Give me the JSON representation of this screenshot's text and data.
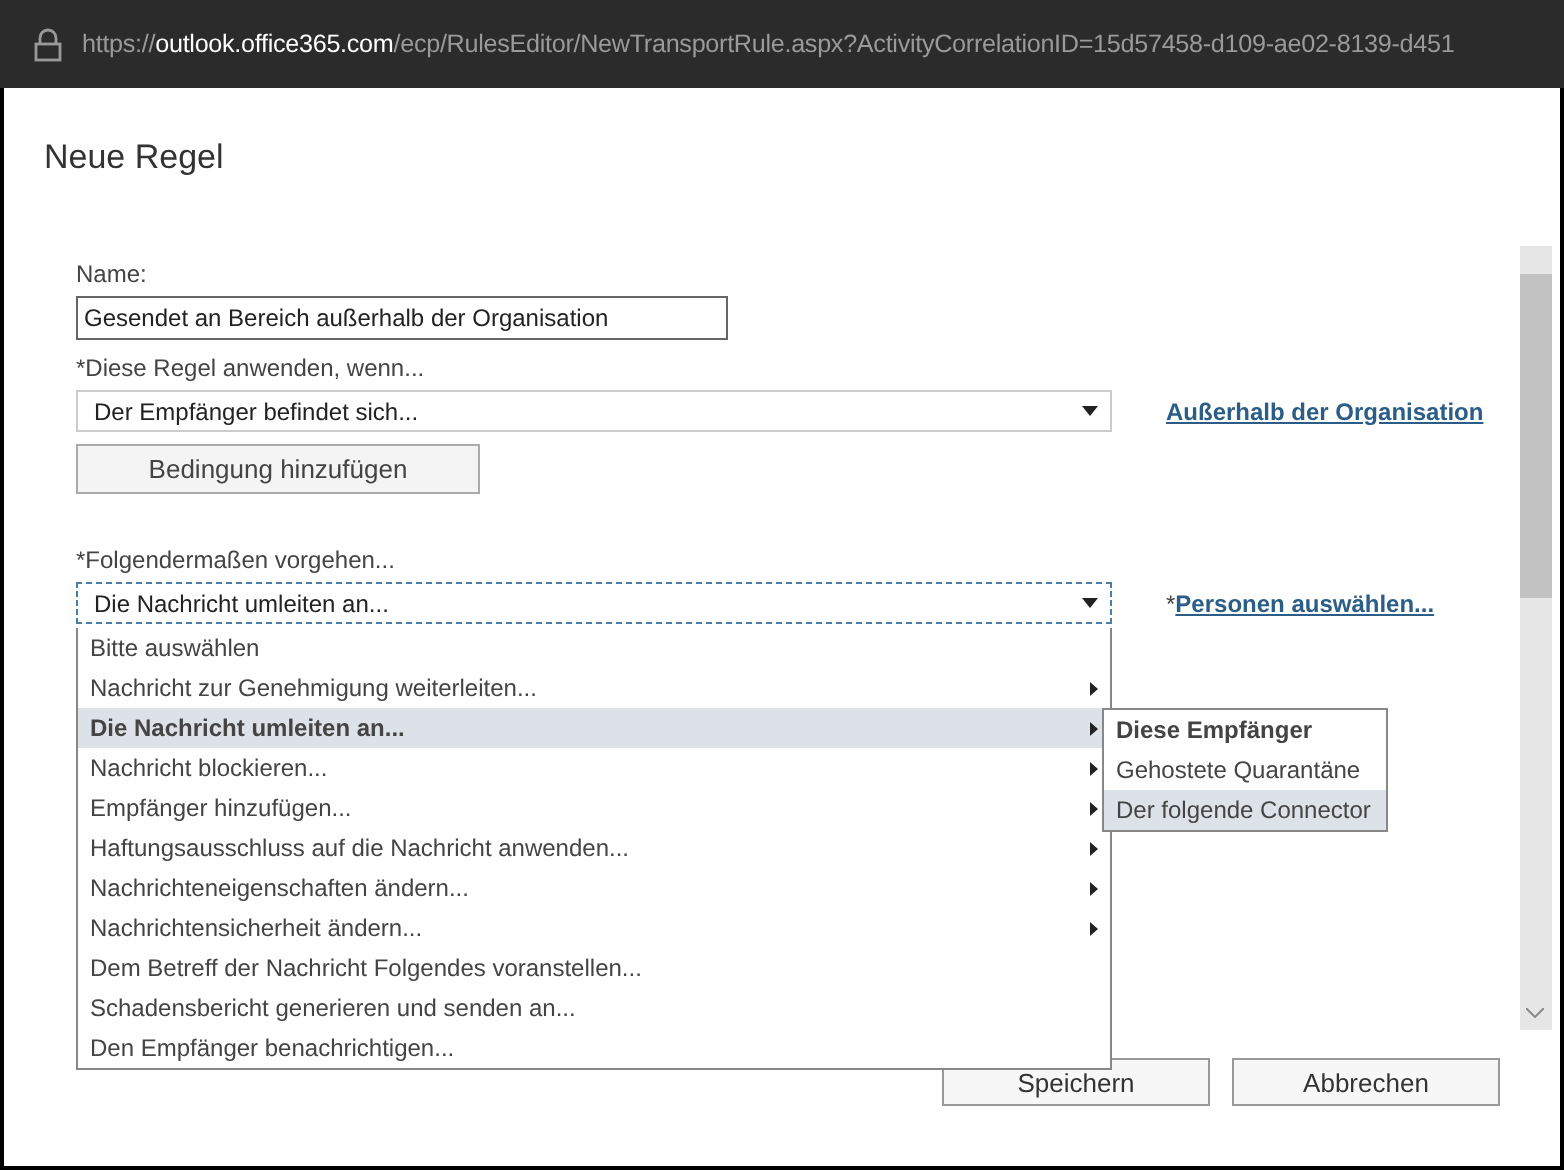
{
  "address_bar": {
    "url_prefix": "https://",
    "url_host": "outlook.office365.com",
    "url_rest": "/ecp/RulesEditor/NewTransportRule.aspx?ActivityCorrelationID=15d57458-d109-ae02-8139-d451"
  },
  "dialog": {
    "title": "Neue Regel"
  },
  "name_field": {
    "label": "Name:",
    "value": "Gesendet an Bereich außerhalb der Organisation"
  },
  "condition": {
    "label": "*Diese Regel anwenden, wenn...",
    "value": "Der Empfänger befindet sich...",
    "link": "Außerhalb der Organisation",
    "add_button": "Bedingung hinzufügen"
  },
  "action": {
    "label": "*Folgendermaßen vorgehen...",
    "value": "Die Nachricht umleiten an...",
    "link_prefix": "*",
    "link": "Personen auswählen...",
    "expanded": true
  },
  "action_menu": [
    {
      "label": "Bitte auswählen",
      "submenu": false,
      "selected": false
    },
    {
      "label": "Nachricht zur Genehmigung weiterleiten...",
      "submenu": true,
      "selected": false
    },
    {
      "label": "Die Nachricht umleiten an...",
      "submenu": true,
      "selected": true
    },
    {
      "label": "Nachricht blockieren...",
      "submenu": true,
      "selected": false
    },
    {
      "label": "Empfänger hinzufügen...",
      "submenu": true,
      "selected": false
    },
    {
      "label": "Haftungsausschluss auf die Nachricht anwenden...",
      "submenu": true,
      "selected": false
    },
    {
      "label": "Nachrichteneigenschaften ändern...",
      "submenu": true,
      "selected": false
    },
    {
      "label": "Nachrichtensicherheit ändern...",
      "submenu": true,
      "selected": false
    },
    {
      "label": "Dem Betreff der Nachricht Folgendes voranstellen...",
      "submenu": false,
      "selected": false
    },
    {
      "label": "Schadensbericht generieren und senden an...",
      "submenu": false,
      "selected": false
    },
    {
      "label": "Den Empfänger benachrichtigen...",
      "submenu": false,
      "selected": false
    }
  ],
  "submenu": [
    {
      "label": "Diese Empfänger",
      "kind": "heading",
      "selected": false
    },
    {
      "label": "Gehostete Quarantäne",
      "kind": "option",
      "selected": false
    },
    {
      "label": "Der folgende Connector",
      "kind": "option",
      "selected": true
    }
  ],
  "buttons": [
    "Speichern",
    "Abbrechen"
  ]
}
